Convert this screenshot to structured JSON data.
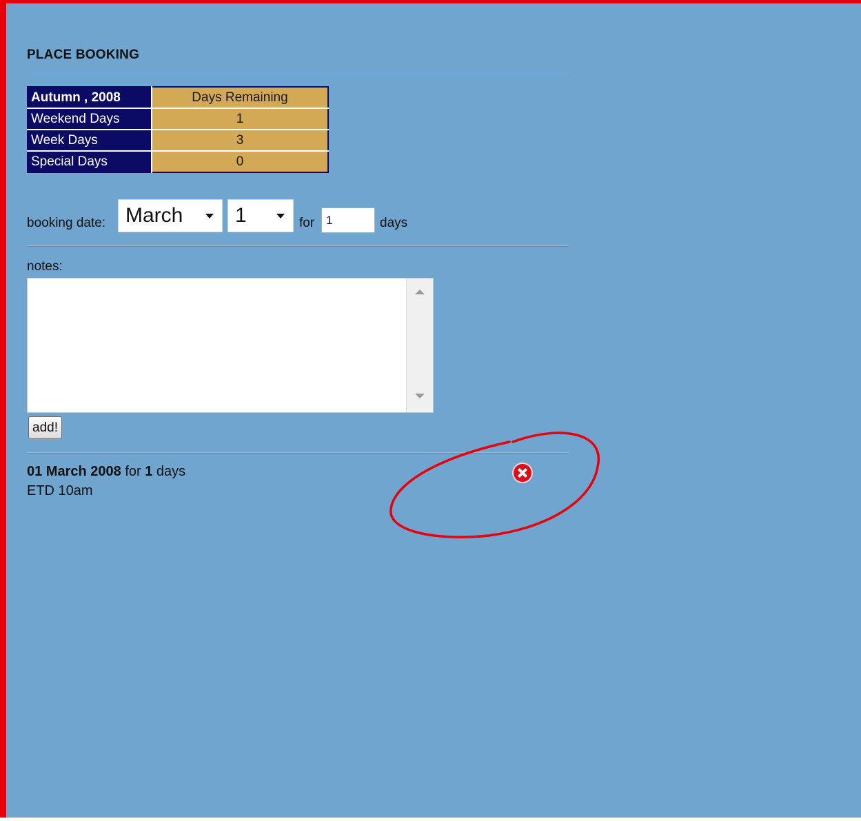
{
  "page": {
    "title": "PLACE BOOKING"
  },
  "days_table": {
    "header_label": "Autumn , 2008",
    "header_value": "Days Remaining",
    "rows": [
      {
        "label": "Weekend Days",
        "value": "1"
      },
      {
        "label": "Week Days",
        "value": "3"
      },
      {
        "label": "Special Days",
        "value": "0"
      }
    ]
  },
  "booking": {
    "date_label": "booking date:",
    "month_selected": "March",
    "day_selected": "1",
    "for_label": "for",
    "days_value": "1",
    "days_label": "days"
  },
  "notes": {
    "label": "notes:",
    "value": ""
  },
  "add_button": {
    "label": "add!"
  },
  "entry": {
    "date": "01 March 2008",
    "for_text": "for",
    "days_count": "1",
    "days_text": "days",
    "note": "ETD 10am"
  },
  "colors": {
    "page_background": "#6fa5cf",
    "border_red": "#e8000b",
    "table_label_bg": "#0b0b66",
    "table_value_bg": "#d4a956",
    "delete_icon": "#d8101b"
  },
  "icons": {
    "delete": "delete-icon",
    "select_caret": "chevron-down-icon"
  }
}
